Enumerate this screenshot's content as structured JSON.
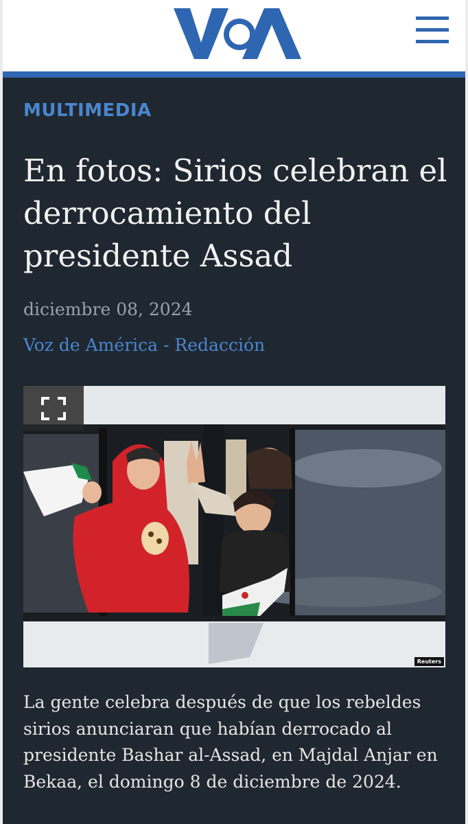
{
  "header": {
    "logo_text": "VOA",
    "menu_icon": "hamburger-menu-icon",
    "brand_color": "#2f66b1"
  },
  "article": {
    "section": "MULTIMEDIA",
    "title": "En fotos: Sirios celebran el derrocamiento del presidente Assad",
    "date": "diciembre 08, 2024",
    "author": "Voz de América - Redacción",
    "photo": {
      "expand_icon": "fullscreen-icon",
      "credit": "Reuters"
    },
    "caption": "La gente celebra después de que los rebeldes sirios anunciaran que habían derrocado al presidente Bashar al-Assad, en Majdal Anjar en Bekaa, el domingo 8 de diciembre de 2024."
  },
  "colors": {
    "background": "#1f2730",
    "accent": "#4a86cf",
    "title": "#f2f2f2",
    "muted": "#9aa2ab"
  }
}
